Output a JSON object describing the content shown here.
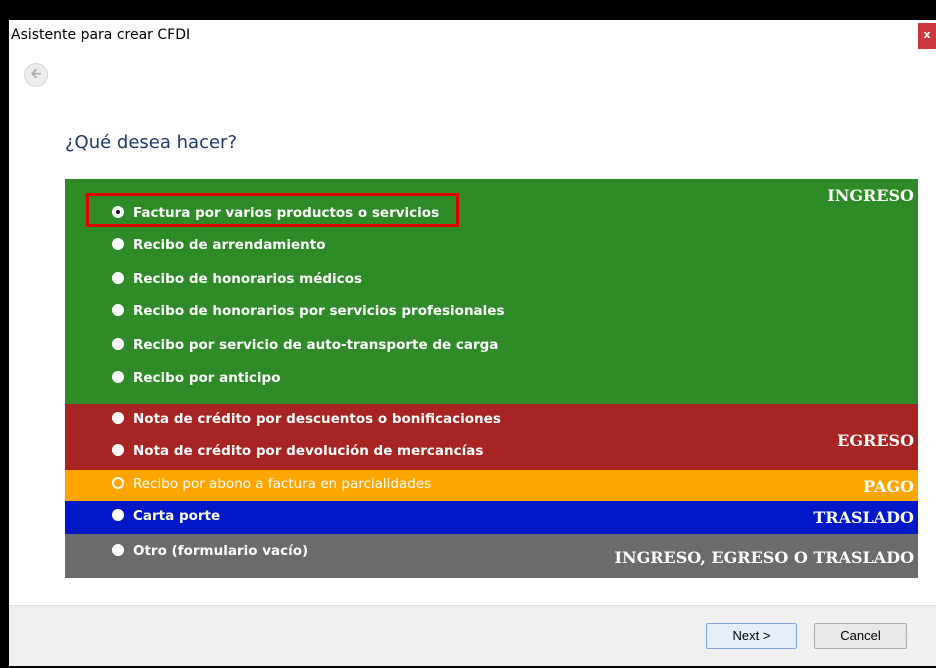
{
  "window": {
    "title": "Asistente para crear CFDI",
    "close_label": "x",
    "back_icon": "back-arrow-icon"
  },
  "question": "¿Qué desea hacer?",
  "sections": {
    "ingreso": {
      "label": "INGRESO",
      "color": "#2e8b27",
      "options": [
        "Factura por varios productos o servicios",
        "Recibo de arrendamiento",
        "Recibo de honorarios médicos",
        "Recibo de honorarios por servicios profesionales",
        "Recibo por servicio de auto-transporte de carga",
        "Recibo por anticipo"
      ]
    },
    "egreso": {
      "label": "EGRESO",
      "color": "#a82423",
      "options": [
        "Nota de crédito por descuentos o bonificaciones",
        "Nota de crédito por devolución de mercancías"
      ]
    },
    "pago": {
      "label": "PAGO",
      "color": "#ffa500",
      "options": [
        "Recibo por abono a factura en parcialidades"
      ]
    },
    "traslado": {
      "label": "TRASLADO",
      "color": "#0018c8",
      "options": [
        "Carta porte"
      ]
    },
    "otro": {
      "label": "INGRESO, EGRESO O TRASLADO",
      "color": "#6b6b6b",
      "options": [
        "Otro (formulario vacío)"
      ]
    }
  },
  "selected_option": "Factura por varios productos o servicios",
  "footer": {
    "next_label": "Next >",
    "cancel_label": "Cancel"
  }
}
